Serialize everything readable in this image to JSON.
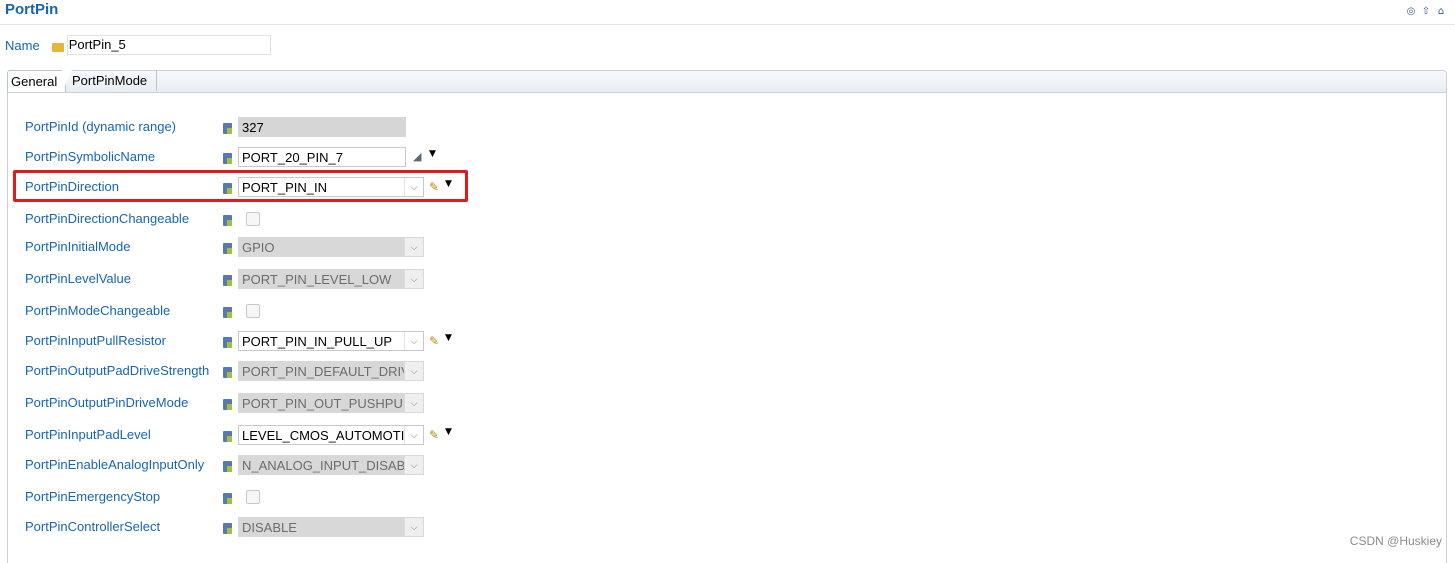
{
  "header": {
    "title": "PortPin",
    "icons": [
      "globe-icon",
      "up-arrow-icon",
      "home-icon"
    ]
  },
  "name_field": {
    "label": "Name",
    "value": "PortPin_5"
  },
  "tabs": [
    {
      "label": "General",
      "active": true
    },
    {
      "label": "PortPinMode",
      "active": false
    }
  ],
  "params": [
    {
      "label": "PortPinId (dynamic range)",
      "kind": "readonly",
      "value": "327"
    },
    {
      "label": "PortPinSymbolicName",
      "kind": "text",
      "value": "PORT_20_PIN_7"
    },
    {
      "label": "PortPinDirection",
      "kind": "select",
      "value": "PORT_PIN_IN"
    },
    {
      "label": "PortPinDirectionChangeable",
      "kind": "checkbox",
      "value": ""
    },
    {
      "label": "PortPinInitialMode",
      "kind": "select-disabled",
      "value": "GPIO"
    },
    {
      "label": "PortPinLevelValue",
      "kind": "select-disabled",
      "value": "PORT_PIN_LEVEL_LOW"
    },
    {
      "label": "PortPinModeChangeable",
      "kind": "checkbox",
      "value": ""
    },
    {
      "label": "PortPinInputPullResistor",
      "kind": "select",
      "value": "PORT_PIN_IN_PULL_UP"
    },
    {
      "label": "PortPinOutputPadDriveStrength",
      "kind": "select-disabled",
      "value": "PORT_PIN_DEFAULT_DRIVER"
    },
    {
      "label": "PortPinOutputPinDriveMode",
      "kind": "select-disabled",
      "value": "PORT_PIN_OUT_PUSHPULL"
    },
    {
      "label": "PortPinInputPadLevel",
      "kind": "select",
      "value": "LEVEL_CMOS_AUTOMOTIVE"
    },
    {
      "label": "PortPinEnableAnalogInputOnly",
      "kind": "select-disabled",
      "value": "N_ANALOG_INPUT_DISABLE"
    },
    {
      "label": "PortPinEmergencyStop",
      "kind": "checkbox",
      "value": ""
    },
    {
      "label": "PortPinControllerSelect",
      "kind": "select-disabled",
      "value": "DISABLE"
    }
  ],
  "watermark": "CSDN @Huskiey",
  "colors": {
    "label_blue": "#1665b5",
    "highlight_red": "#e01b1b"
  }
}
